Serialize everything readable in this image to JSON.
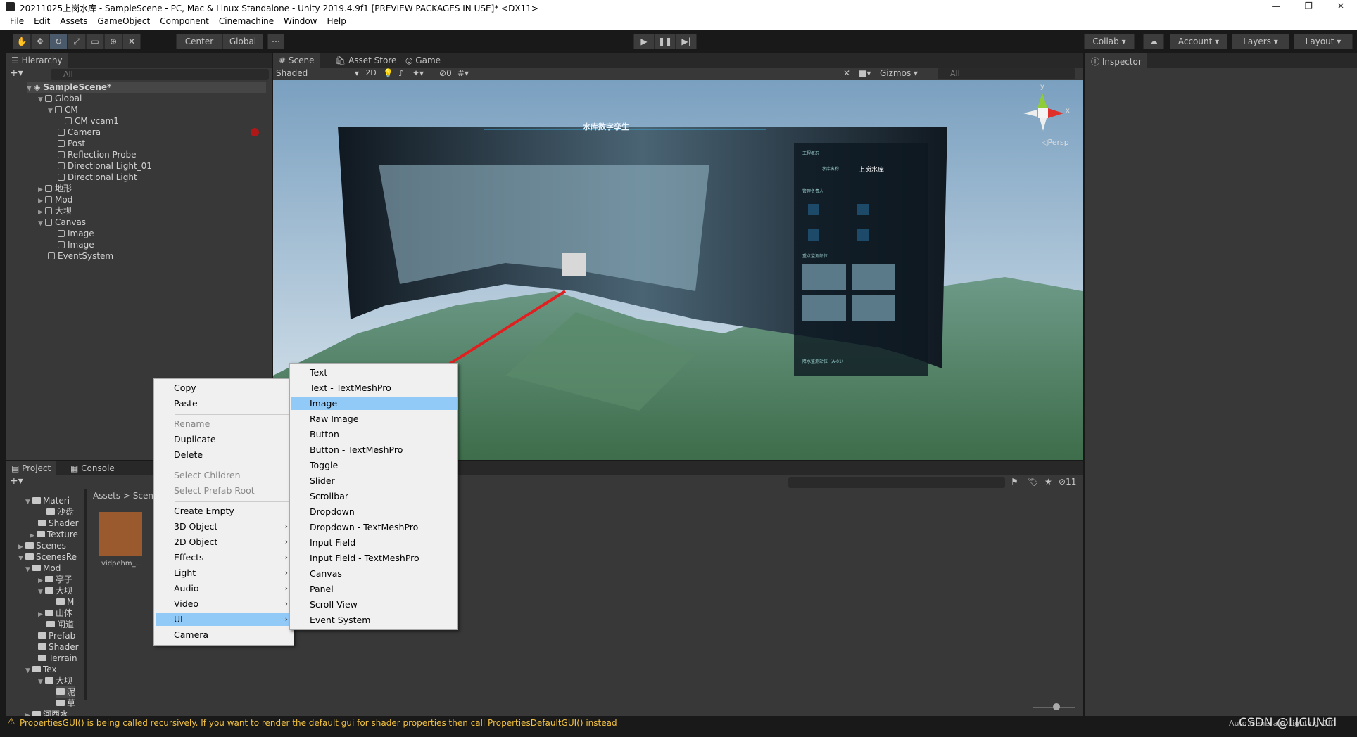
{
  "window": {
    "title": "20211025上岗水库 - SampleScene - PC, Mac & Linux Standalone - Unity 2019.4.9f1 [PREVIEW PACKAGES IN USE]* <DX11>"
  },
  "menu": [
    "File",
    "Edit",
    "Assets",
    "GameObject",
    "Component",
    "Cinemachine",
    "Window",
    "Help"
  ],
  "toolbar": {
    "pivot": "Center",
    "space": "Global",
    "collab": "Collab",
    "account": "Account",
    "layers": "Layers",
    "layout": "Layout"
  },
  "hierarchy": {
    "tab": "Hierarchy",
    "search_placeholder": "All",
    "scene": "SampleScene*",
    "items": [
      "Global",
      "CM",
      "CM vcam1",
      "Camera",
      "Post",
      "Reflection Probe",
      "Directional Light_01",
      "Directional Light",
      "地形",
      "Mod",
      "大坝",
      "Canvas",
      "Image",
      "Image",
      "EventSystem"
    ]
  },
  "scene_view": {
    "tabs": [
      "Scene",
      "Asset Store",
      "Game"
    ],
    "shading": "Shaded",
    "mode_2d": "2D",
    "hidden_count": "0",
    "gizmos": "Gizmos",
    "search_placeholder": "All",
    "persp": "Persp",
    "axis_y": "y",
    "axis_x": "x",
    "hud": {
      "title": "水库数字孪生",
      "section1": "工程概况",
      "reservoir_label": "水库名称",
      "reservoir_name": "上岗水库",
      "section2": "管理负责人",
      "section3": "重点监测部位",
      "section4": "降水监测站位（A-01）"
    }
  },
  "inspector": {
    "tab": "Inspector"
  },
  "project": {
    "tabs": [
      "Project",
      "Console"
    ],
    "breadcrumb": [
      "Assets",
      "Scene"
    ],
    "tree": [
      "Materi",
      "沙盘",
      "Shader",
      "Texture",
      "Scenes",
      "ScenesRe",
      "Mod",
      "亭子",
      "大坝",
      "M",
      "山体",
      "闸道",
      "Prefab",
      "Shader",
      "Terrain",
      "Tex",
      "大坝",
      "泥",
      "草",
      "河西水"
    ],
    "asset_label": "vidpehm_...",
    "count": "11"
  },
  "context_menu": {
    "items": [
      "Copy",
      "Paste",
      "Rename",
      "Duplicate",
      "Delete",
      "Select Children",
      "Select Prefab Root",
      "Create Empty",
      "3D Object",
      "2D Object",
      "Effects",
      "Light",
      "Audio",
      "Video",
      "UI",
      "Camera"
    ]
  },
  "ui_submenu": {
    "items": [
      "Text",
      "Text - TextMeshPro",
      "Image",
      "Raw Image",
      "Button",
      "Button - TextMeshPro",
      "Toggle",
      "Slider",
      "Scrollbar",
      "Dropdown",
      "Dropdown - TextMeshPro",
      "Input Field",
      "Input Field - TextMeshPro",
      "Canvas",
      "Panel",
      "Scroll View",
      "Event System"
    ],
    "selected": "Image"
  },
  "status": {
    "warning": "PropertiesGUI() is being called recursively. If you want to render the default gui for shader properties then call PropertiesDefaultGUI() instead",
    "right": "Auto Generate Lighting Off",
    "watermark": "CSDN @LICUNCI"
  },
  "colors": {
    "selection": "#91c9f7",
    "warning": "#f0c040",
    "arrow": "#e02020"
  }
}
